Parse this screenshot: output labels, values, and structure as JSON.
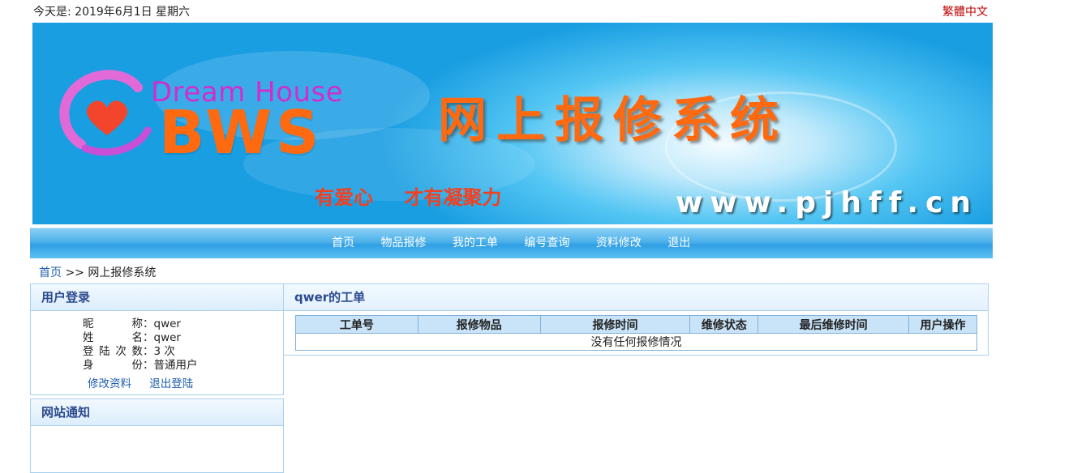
{
  "top": {
    "date_text": "今天是: 2019年6月1日 星期六",
    "lang_link": "繁體中文"
  },
  "banner": {
    "brand_line1": "Dream House",
    "brand_line2": "BWS",
    "system_title": "网上报修系统",
    "slogan": "有爱心 才有凝聚力",
    "website": "www.pjhff.cn"
  },
  "nav": {
    "items": [
      {
        "label": "首页"
      },
      {
        "label": "物品报修"
      },
      {
        "label": "我的工单"
      },
      {
        "label": "编号查询"
      },
      {
        "label": "资料修改"
      },
      {
        "label": "退出"
      }
    ]
  },
  "breadcrumb": {
    "home": "首页",
    "separator": ">>",
    "current": "网上报修系统"
  },
  "login_panel": {
    "title": "用户登录",
    "rows": [
      {
        "label": "昵 称",
        "value": "qwer"
      },
      {
        "label": "姓 名",
        "value": "qwer"
      },
      {
        "label": "登陆次数",
        "value": "3 次"
      },
      {
        "label": "身 份",
        "value": "普通用户"
      }
    ],
    "edit_link": "修改资料",
    "logout_link": "退出登陆"
  },
  "notice_panel": {
    "title": "网站通知"
  },
  "orders_panel": {
    "title": "qwer的工单",
    "columns": [
      "工单号",
      "报修物品",
      "报修时间",
      "维修状态",
      "最后维修时间",
      "用户操作"
    ],
    "empty_text": "没有任何报修情况"
  },
  "colors": {
    "lang_link": "#c00000",
    "brand_orange": "#ff6a10",
    "brand_magenta": "#d22ccf",
    "nav_blue": "#3aa8e8",
    "panel_border": "#a9d1ee",
    "panel_title": "#2d4b8e",
    "link_blue": "#1f5fae"
  }
}
